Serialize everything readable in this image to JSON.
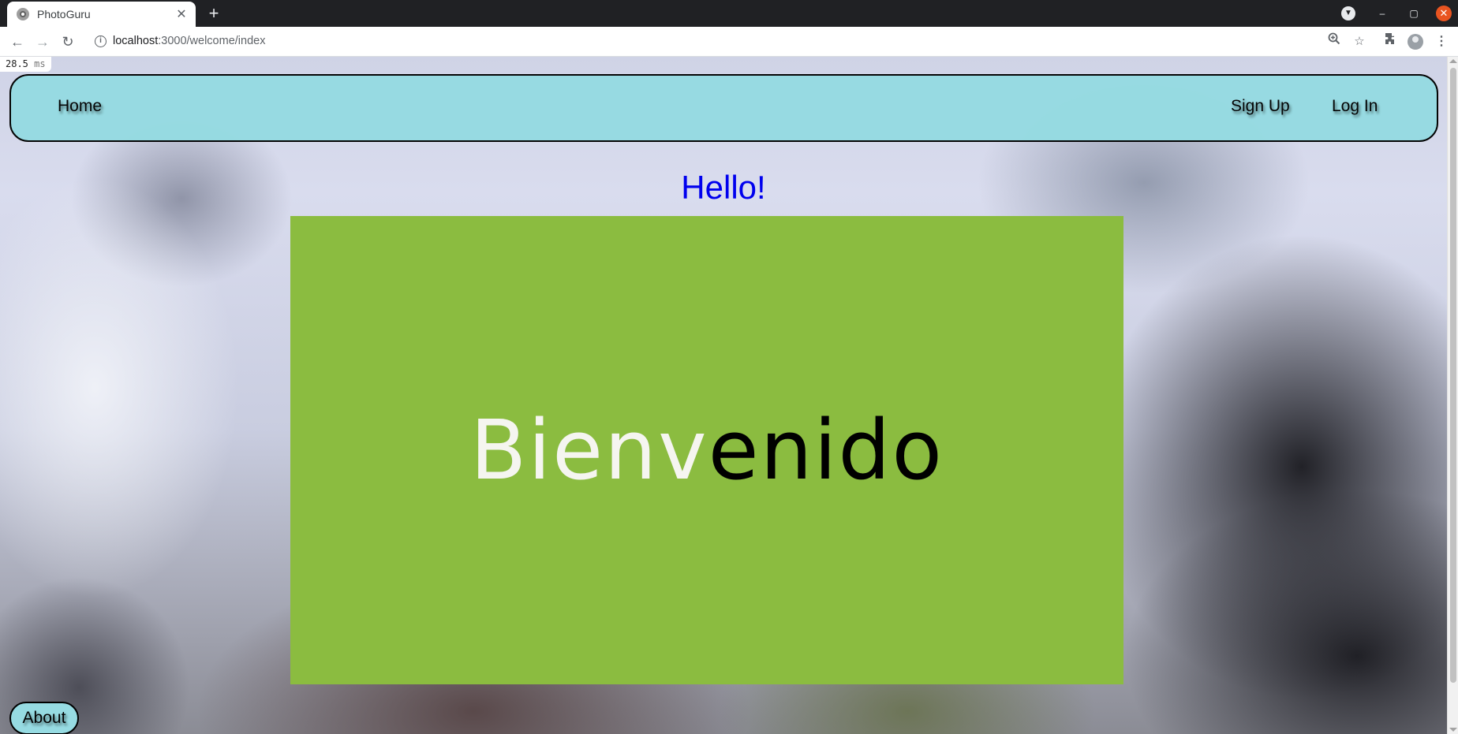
{
  "browser": {
    "tab": {
      "title": "PhotoGuru",
      "close": "✕"
    },
    "new_tab": "+",
    "window_controls": {
      "minimize": "–",
      "maximize": "▢",
      "close": "✕"
    },
    "nav": {
      "back": "←",
      "forward": "→",
      "reload": "↻"
    },
    "url": {
      "host": "localhost",
      "rest": ":3000/welcome/index"
    },
    "toolbar_icons": [
      "zoom-icon",
      "star-icon",
      "extensions-icon",
      "profile-icon",
      "menu-icon"
    ]
  },
  "page": {
    "timing": {
      "value": "28.5",
      "unit": "ms"
    },
    "nav": {
      "home": "Home",
      "sign_up": "Sign Up",
      "log_in": "Log In"
    },
    "heading": "Hello!",
    "banner": {
      "light_text": "Bienv",
      "dark_text": "enido",
      "color": "#8bbc40"
    },
    "about": "About"
  },
  "colors": {
    "navbar": "#96dbe2",
    "heading": "#0000ee",
    "win_close": "#e95420"
  }
}
